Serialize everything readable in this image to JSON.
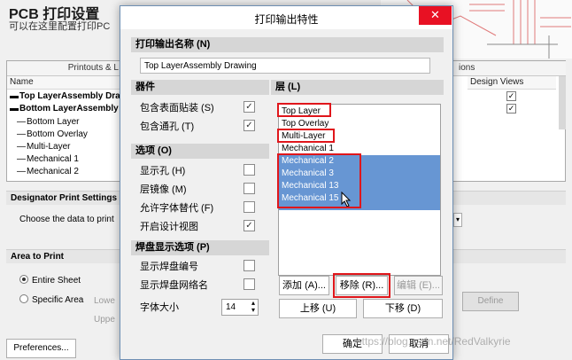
{
  "background_window": {
    "title": "PCB 打印设置",
    "subtitle_visible": "可以在这里配置打印PC",
    "table": {
      "group_header": "Printouts & L",
      "right_header": "ions",
      "name_column": "Name",
      "design_views_column": "Design Views",
      "rows": [
        {
          "label": "Top LayerAssembly Dra",
          "level": "top",
          "design_views_checked": true
        },
        {
          "label": "Bottom LayerAssembly",
          "level": "top",
          "design_views_checked": true
        },
        {
          "label": "Bottom Layer",
          "level": "child"
        },
        {
          "label": "Bottom Overlay",
          "level": "child"
        },
        {
          "label": "Multi-Layer",
          "level": "child"
        },
        {
          "label": "Mechanical 1",
          "level": "child"
        },
        {
          "label": "Mechanical 2",
          "level": "child"
        }
      ]
    },
    "designator_section": "Designator Print Settings",
    "designator_text": "Choose the data to print",
    "area_section": "Area to Print",
    "entire_sheet": "Entire Sheet",
    "specific_area": "Specific Area",
    "lower_label": "Lowe",
    "upper_label": "Uppe",
    "define_button": "Define",
    "preferences_button": "Preferences..."
  },
  "dialog": {
    "title": "打印输出特性",
    "close_glyph": "✕",
    "name_group": "打印输出名称 (N)",
    "name_value": "Top LayerAssembly Drawing",
    "components_group": "器件",
    "include_smt": "包含表面贴装 (S)",
    "include_smt_checked": true,
    "include_through": "包含通孔 (T)",
    "include_through_checked": true,
    "options_group": "选项 (O)",
    "show_holes": "显示孔 (H)",
    "show_holes_checked": false,
    "mirror_layers": "层镜像 (M)",
    "mirror_layers_checked": false,
    "font_substitution": "允许字体替代 (F)",
    "font_substitution_checked": false,
    "design_views": "开启设计视图",
    "design_views_checked": true,
    "pad_group": "焊盘显示选项 (P)",
    "pad_numbers": "显示焊盘编号",
    "pad_numbers_checked": false,
    "pad_nets": "显示焊盘网络名",
    "pad_nets_checked": false,
    "font_size_label": "字体大小",
    "font_size_value": "14",
    "layers_group": "层 (L)",
    "layers": [
      {
        "label": "Top Layer",
        "selected": false
      },
      {
        "label": "Top Overlay",
        "selected": false
      },
      {
        "label": "Multi-Layer",
        "selected": false
      },
      {
        "label": "Mechanical 1",
        "selected": false
      },
      {
        "label": "Mechanical 2",
        "selected": true
      },
      {
        "label": "Mechanical 3",
        "selected": true
      },
      {
        "label": "Mechanical 13",
        "selected": true
      },
      {
        "label": "Mechanical 15",
        "selected": true
      }
    ],
    "add_button": "添加 (A)...",
    "remove_button": "移除 (R)...",
    "edit_button": "编辑 (E)...",
    "up_button": "上移 (U)",
    "down_button": "下移 (D)",
    "ok_button": "确定",
    "cancel_button": "取消",
    "watermark": "https://blog.csdn.net/RedValkyrie"
  },
  "colors": {
    "highlight_red": "#e0161b",
    "selection_blue": "#6796d3",
    "close_red": "#e81123"
  }
}
